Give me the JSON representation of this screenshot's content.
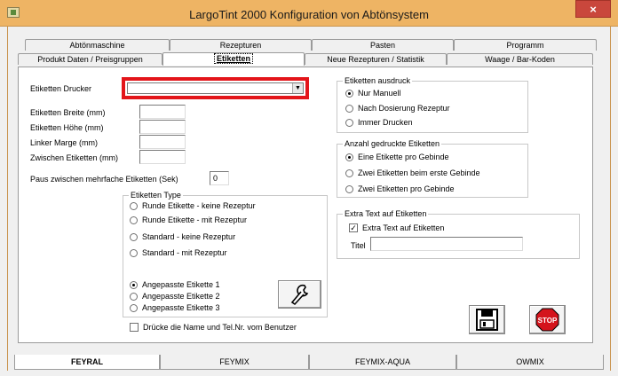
{
  "window": {
    "title": "LargoTint 2000 Konfiguration von Abtönsystem",
    "close": "×"
  },
  "tabs_row1": [
    {
      "label": "Abtönmaschine"
    },
    {
      "label": "Rezepturen"
    },
    {
      "label": "Pasten"
    },
    {
      "label": "Programm"
    }
  ],
  "tabs_row2": [
    {
      "label": "Produkt Daten / Preisgruppen"
    },
    {
      "label": "Etiketten"
    },
    {
      "label": "Neue Rezepturen / Statistik"
    },
    {
      "label": "Waage / Bar-Koden"
    }
  ],
  "left": {
    "printer_label": "Etiketten Drucker",
    "printer_value": "",
    "width_label": "Etiketten Breite (mm)",
    "width_value": "",
    "height_label": "Etiketten Höhe (mm)",
    "height_value": "",
    "margin_label": "Linker Marge (mm)",
    "margin_value": "",
    "gap_label": "Zwischen Etiketten (mm)",
    "gap_value": "",
    "pause_label": "Paus zwischen mehrfache Etiketten (Sek)",
    "pause_value": "0"
  },
  "typ_group": {
    "title": "Etiketten Type",
    "options": [
      {
        "label": "Runde Etikette - keine Rezeptur"
      },
      {
        "label": "Runde Etikette - mit Rezeptur"
      },
      {
        "label": "Standard - keine Rezeptur"
      },
      {
        "label": "Standard - mit Rezeptur"
      },
      {
        "label": "Angepasste Etikette 1"
      },
      {
        "label": "Angepasste Etikette 2"
      },
      {
        "label": "Angepasste Etikette 3"
      }
    ],
    "selected": 4
  },
  "user_check": {
    "label": "Drücke die Name und Tel.Nr. vom Benutzer",
    "checked": false
  },
  "ausdruck": {
    "title": "Etiketten ausdruck",
    "options": [
      {
        "label": "Nur Manuell"
      },
      {
        "label": "Nach Dosierung Rezeptur"
      },
      {
        "label": "Immer Drucken"
      }
    ],
    "selected": 0
  },
  "anzahl": {
    "title": "Anzahl gedruckte Etiketten",
    "options": [
      {
        "label": "Eine Etikette pro Gebinde"
      },
      {
        "label": "Zwei Etiketten beim erste Gebinde"
      },
      {
        "label": "Zwei Etiketten pro Gebinde"
      }
    ],
    "selected": 0
  },
  "extra": {
    "title": "Extra Text auf Etiketten",
    "check_label": "Extra Text auf Etiketten",
    "checked": true,
    "titel_label": "Titel",
    "titel_value": ""
  },
  "buttons": {
    "stop_label": "STOP"
  },
  "bottom_tabs": [
    {
      "label": "FEYRAL"
    },
    {
      "label": "FEYMIX"
    },
    {
      "label": "FEYMIX-AQUA"
    },
    {
      "label": "OWMIX"
    }
  ],
  "colors": {
    "title_bar": "#eeb464",
    "highlight": "#e3151a",
    "close": "#c9473c",
    "stop": "#d4141c"
  },
  "icons": [
    "app-icon",
    "close-icon",
    "wrench-icon",
    "save-icon",
    "stop-sign-icon",
    "dropdown-arrow-icon"
  ]
}
